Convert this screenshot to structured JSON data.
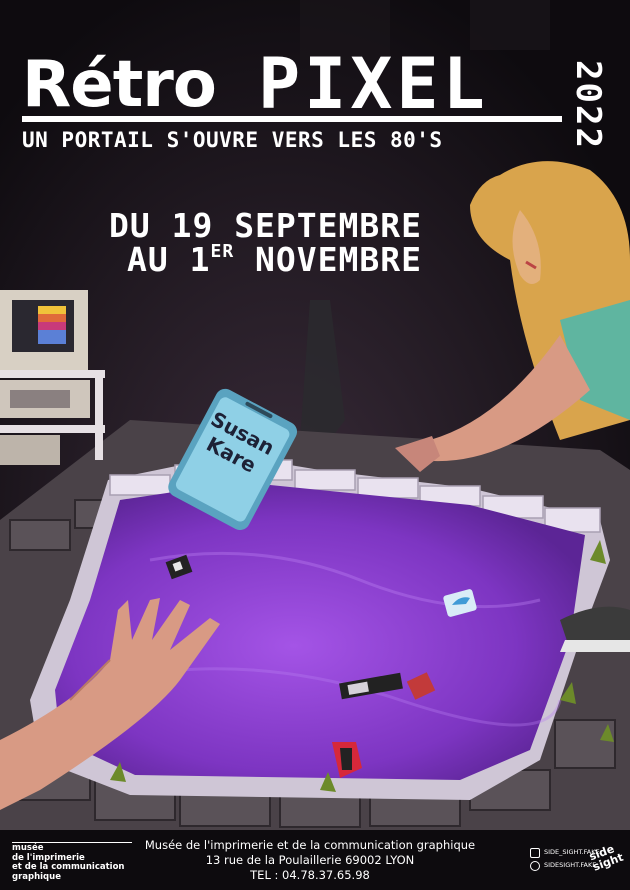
{
  "title": {
    "part1": "Rétro",
    "part2": "PIXEL",
    "year": "2022"
  },
  "subtitle": "UN PORTAIL S'OUVRE VERS LES 80'S",
  "dates": {
    "line1": "DU 19 SEPTEMBRE",
    "line2_prefix": "AU 1",
    "line2_sup": "ER",
    "line2_suffix": " NOVEMBRE"
  },
  "phone": {
    "line1": "Susan",
    "line2": "Kare"
  },
  "logo": {
    "line1": "musée",
    "line2": "de l'imprimerie",
    "line3": "et de la communication",
    "line4": "graphique"
  },
  "address": {
    "name": "Musée de l'imprimerie et de la communication graphique",
    "street": "13 rue de la Poulaillerie 69002 LYON",
    "phone": "TEL : 04.78.37.65.98"
  },
  "social": {
    "instagram": "SIDE_SIGHT.FAKE",
    "web": "SIDESIGHT.FAKE",
    "brand_line1": "side",
    "brand_line2": "sight"
  },
  "colors": {
    "pool": "#8a3ed0",
    "pool_edge": "#e8dcf2",
    "background": "#141016",
    "hair": "#d9a44c",
    "shirt": "#5fb5a0",
    "phone_screen": "#7ec4dc",
    "skin": "#d89a84"
  },
  "icons": [
    "instagram-icon",
    "globe-icon",
    "twitter-bird-icon",
    "retro-computer-icon"
  ]
}
